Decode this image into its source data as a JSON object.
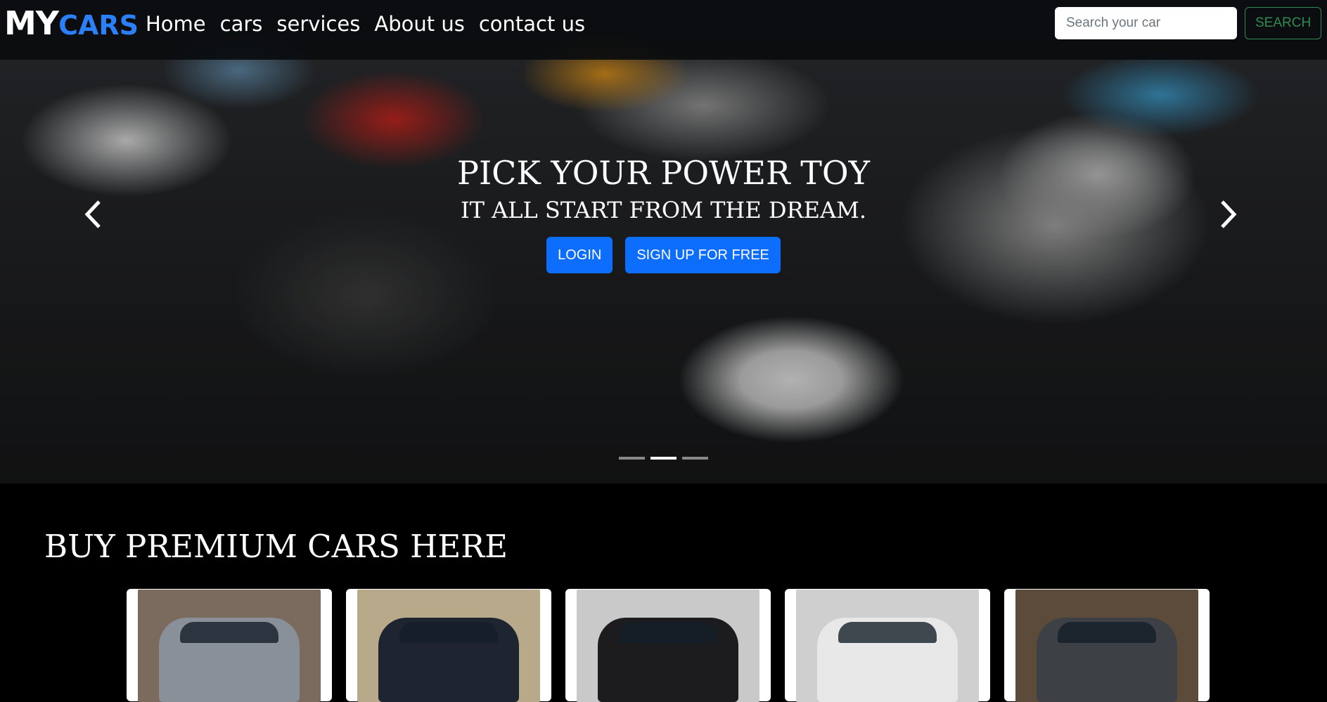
{
  "navbar": {
    "brand_my": "MY",
    "brand_cars": "CARS",
    "links": [
      "Home",
      "cars",
      "services",
      "About us",
      "contact us"
    ],
    "search_placeholder": "Search your car",
    "search_button": "SEARCH"
  },
  "hero": {
    "title": "PICK YOUR POWER TOY",
    "subtitle": "IT ALL START FROM THE DREAM.",
    "login_button": "LOGIN",
    "signup_button": "SIGN UP FOR FREE",
    "prev_icon": "chevron-left-icon",
    "next_icon": "chevron-right-icon",
    "slides": 3,
    "active_slide": 2
  },
  "products": {
    "title": "BUY PREMIUM CARS HERE",
    "cards": [
      {
        "name": "silver-blue-mustang",
        "color": "#8a9099",
        "bg": "#7a6b5e"
      },
      {
        "name": "dark-audi-sedan",
        "color": "#1f2530",
        "bg": "#b7a98a"
      },
      {
        "name": "black-bmw-sedan",
        "color": "#1c1c1e",
        "bg": "#c9c9c9"
      },
      {
        "name": "white-bentley",
        "color": "#e8e8e8",
        "bg": "#cfcfcf"
      },
      {
        "name": "grey-range-rover",
        "color": "#3d4146",
        "bg": "#5c4a3a"
      }
    ]
  },
  "colors": {
    "accent": "#2b7ff8",
    "primary_button": "#0d6efd",
    "search_button": "#2f8a52",
    "background": "#000000"
  }
}
